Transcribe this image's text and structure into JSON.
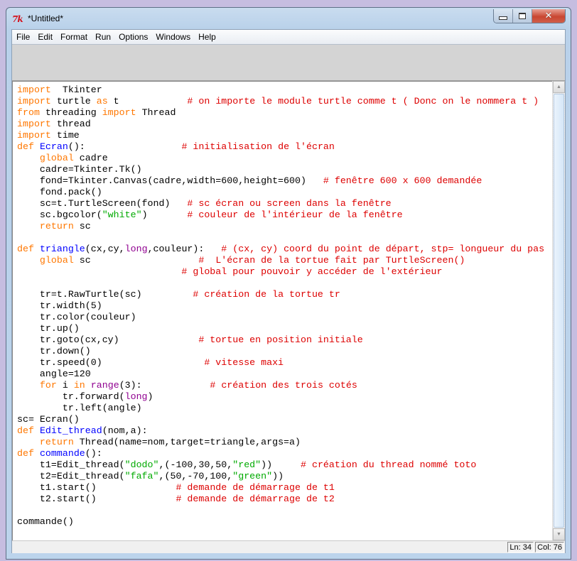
{
  "window": {
    "title": "*Untitled*",
    "app_icon_text": "7k",
    "controls": {
      "minimize": "minimize",
      "maximize": "maximize",
      "close": "✕"
    }
  },
  "menubar": {
    "items": [
      "File",
      "Edit",
      "Format",
      "Run",
      "Options",
      "Windows",
      "Help"
    ]
  },
  "editor": {
    "language": "python",
    "lines": [
      [
        [
          "kw",
          "import"
        ],
        [
          "t",
          "  Tkinter"
        ]
      ],
      [
        [
          "kw",
          "import"
        ],
        [
          "t",
          " turtle "
        ],
        [
          "kw",
          "as"
        ],
        [
          "t",
          " t            "
        ],
        [
          "cmt",
          "# on importe le module turtle comme t ( Donc on le nommera t )"
        ]
      ],
      [
        [
          "kw",
          "from"
        ],
        [
          "t",
          " threading "
        ],
        [
          "kw",
          "import"
        ],
        [
          "t",
          " Thread"
        ]
      ],
      [
        [
          "kw",
          "import"
        ],
        [
          "t",
          " thread"
        ]
      ],
      [
        [
          "kw",
          "import"
        ],
        [
          "t",
          " time"
        ]
      ],
      [
        [
          "kw",
          "def"
        ],
        [
          "t",
          " "
        ],
        [
          "def",
          "Ecran"
        ],
        [
          "t",
          "():                 "
        ],
        [
          "cmt",
          "# initialisation de l'écran"
        ]
      ],
      [
        [
          "t",
          "    "
        ],
        [
          "kw",
          "global"
        ],
        [
          "t",
          " cadre"
        ]
      ],
      [
        [
          "t",
          "    cadre=Tkinter.Tk()"
        ]
      ],
      [
        [
          "t",
          "    fond=Tkinter.Canvas(cadre,width=600,height=600)   "
        ],
        [
          "cmt",
          "# fenêtre 600 x 600 demandée"
        ]
      ],
      [
        [
          "t",
          "    fond.pack()"
        ]
      ],
      [
        [
          "t",
          "    sc=t.TurtleScreen(fond)   "
        ],
        [
          "cmt",
          "# sc écran ou screen dans la fenêtre"
        ]
      ],
      [
        [
          "t",
          "    sc.bgcolor("
        ],
        [
          "str",
          "\"white\""
        ],
        [
          "t",
          ")       "
        ],
        [
          "cmt",
          "# couleur de l'intérieur de la fenêtre"
        ]
      ],
      [
        [
          "t",
          "    "
        ],
        [
          "kw",
          "return"
        ],
        [
          "t",
          " sc"
        ]
      ],
      [],
      [
        [
          "kw",
          "def"
        ],
        [
          "t",
          " "
        ],
        [
          "def",
          "triangle"
        ],
        [
          "t",
          "(cx,cy,"
        ],
        [
          "bi",
          "long"
        ],
        [
          "t",
          ",couleur):   "
        ],
        [
          "cmt",
          "# (cx, cy) coord du point de départ, stp= longueur du pas"
        ]
      ],
      [
        [
          "t",
          "    "
        ],
        [
          "kw",
          "global"
        ],
        [
          "t",
          " sc                   "
        ],
        [
          "cmt",
          "#  L'écran de la tortue fait par TurtleScreen()"
        ]
      ],
      [
        [
          "t",
          "                             "
        ],
        [
          "cmt",
          "# global pour pouvoir y accéder de l'extérieur"
        ]
      ],
      [],
      [
        [
          "t",
          "    tr=t.RawTurtle(sc)         "
        ],
        [
          "cmt",
          "# création de la tortue tr"
        ]
      ],
      [
        [
          "t",
          "    tr.width(5)"
        ]
      ],
      [
        [
          "t",
          "    tr.color(couleur)"
        ]
      ],
      [
        [
          "t",
          "    tr.up()"
        ]
      ],
      [
        [
          "t",
          "    tr.goto(cx,cy)              "
        ],
        [
          "cmt",
          "# tortue en position initiale"
        ]
      ],
      [
        [
          "t",
          "    tr.down()"
        ]
      ],
      [
        [
          "t",
          "    tr.speed(0)                  "
        ],
        [
          "cmt",
          "# vitesse maxi"
        ]
      ],
      [
        [
          "t",
          "    angle=120"
        ]
      ],
      [
        [
          "t",
          "    "
        ],
        [
          "kw",
          "for"
        ],
        [
          "t",
          " i "
        ],
        [
          "kw",
          "in"
        ],
        [
          "t",
          " "
        ],
        [
          "bi",
          "range"
        ],
        [
          "t",
          "(3):            "
        ],
        [
          "cmt",
          "# création des trois cotés"
        ]
      ],
      [
        [
          "t",
          "        tr.forward("
        ],
        [
          "bi",
          "long"
        ],
        [
          "t",
          ")"
        ]
      ],
      [
        [
          "t",
          "        tr.left(angle)"
        ]
      ],
      [
        [
          "t",
          "sc= Ecran()"
        ]
      ],
      [
        [
          "kw",
          "def"
        ],
        [
          "t",
          " "
        ],
        [
          "def",
          "Edit_thread"
        ],
        [
          "t",
          "(nom,a):"
        ]
      ],
      [
        [
          "t",
          "    "
        ],
        [
          "kw",
          "return"
        ],
        [
          "t",
          " Thread(name=nom,target=triangle,args=a)"
        ]
      ],
      [
        [
          "kw",
          "def"
        ],
        [
          "t",
          " "
        ],
        [
          "def",
          "commande"
        ],
        [
          "t",
          "():"
        ]
      ],
      [
        [
          "t",
          "    t1=Edit_thread("
        ],
        [
          "str",
          "\"dodo\""
        ],
        [
          "t",
          ",(-100,30,50,"
        ],
        [
          "str",
          "\"red\""
        ],
        [
          "t",
          "))     "
        ],
        [
          "cmt",
          "# création du thread nommé toto"
        ]
      ],
      [
        [
          "t",
          "    t2=Edit_thread("
        ],
        [
          "str",
          "\"fafa\""
        ],
        [
          "t",
          ",(50,-70,100,"
        ],
        [
          "str",
          "\"green\""
        ],
        [
          "t",
          "))"
        ]
      ],
      [
        [
          "t",
          "    t1.start()              "
        ],
        [
          "cmt",
          "# demande de démarrage de t1"
        ]
      ],
      [
        [
          "t",
          "    t2.start()              "
        ],
        [
          "cmt",
          "# demande de démarrage de t2"
        ]
      ],
      [],
      [
        [
          "t",
          "commande()"
        ]
      ]
    ]
  },
  "statusbar": {
    "line": "Ln: 34",
    "column": "Col: 76"
  },
  "colors": {
    "keyword": "#ff7700",
    "definition": "#0000ff",
    "string": "#00aa00",
    "comment": "#dd0000",
    "builtin": "#900090"
  }
}
